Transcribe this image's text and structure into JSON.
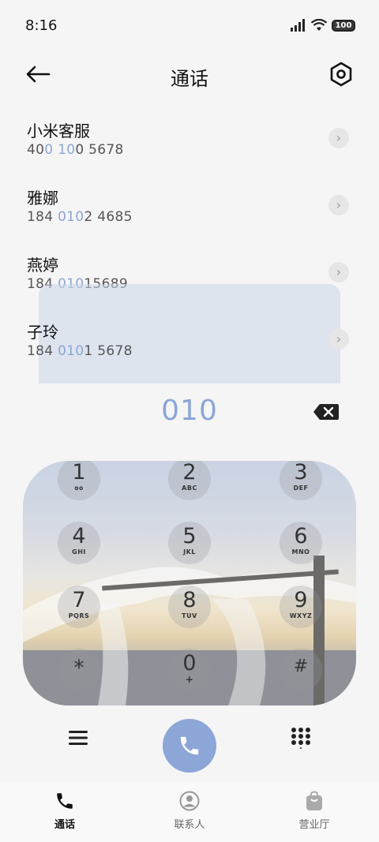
{
  "status_bar": {
    "time": "8:16",
    "battery": "100"
  },
  "header": {
    "title": "通话"
  },
  "contacts": [
    {
      "name": "小米客服",
      "number_parts": [
        "40",
        "0",
        " ",
        "10",
        "0 5678"
      ]
    },
    {
      "name": "雅娜",
      "number_parts": [
        "184 ",
        "010",
        "2 4685",
        "",
        ""
      ]
    },
    {
      "name": "燕婷",
      "number_parts": [
        "184 ",
        "010",
        "15689",
        "",
        ""
      ]
    },
    {
      "name": "子玲",
      "number_parts": [
        "184 ",
        "010",
        "1 5678",
        "",
        ""
      ]
    }
  ],
  "dial": {
    "number": "010"
  },
  "keypad": [
    {
      "digit": "1",
      "letters": ""
    },
    {
      "digit": "2",
      "letters": "ABC"
    },
    {
      "digit": "3",
      "letters": "DEF"
    },
    {
      "digit": "4",
      "letters": "GHI"
    },
    {
      "digit": "5",
      "letters": "JKL"
    },
    {
      "digit": "6",
      "letters": "MNO"
    },
    {
      "digit": "7",
      "letters": "PQRS"
    },
    {
      "digit": "8",
      "letters": "TUV"
    },
    {
      "digit": "9",
      "letters": "WXYZ"
    },
    {
      "digit": "*",
      "letters": ""
    },
    {
      "digit": "0",
      "letters": "+"
    },
    {
      "digit": "#",
      "letters": ""
    }
  ],
  "bottom_nav": {
    "calls": "通话",
    "contacts": "联系人",
    "store": "营业厅"
  },
  "colors": {
    "accent": "#8ca6d8",
    "highlight": "#8ca6d6"
  }
}
